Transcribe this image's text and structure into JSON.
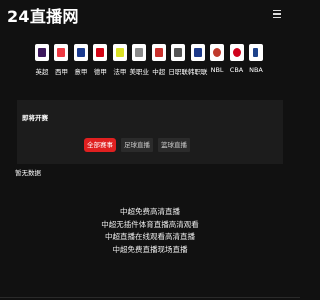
{
  "header": {
    "logo": "24直播网",
    "menu_icon": "hamburger-menu-icon"
  },
  "leagues": [
    {
      "label": "英超",
      "icon": "premier-league-logo",
      "color": "#3d185c"
    },
    {
      "label": "西甲",
      "icon": "laliga-logo",
      "color": "#ee3a43"
    },
    {
      "label": "意甲",
      "icon": "serie-a-logo",
      "color": "#1b3b8f"
    },
    {
      "label": "德甲",
      "icon": "bundesliga-logo",
      "color": "#d20515"
    },
    {
      "label": "法甲",
      "icon": "ligue-1-logo",
      "color": "#dae025"
    },
    {
      "label": "美职业",
      "icon": "mls-logo",
      "color": "#8a8a8a"
    },
    {
      "label": "中超",
      "icon": "csl-logo",
      "color": "#c9302c"
    },
    {
      "label": "日职联",
      "icon": "j-league-logo",
      "color": "#555555"
    },
    {
      "label": "韩职联",
      "icon": "k-league-logo",
      "color": "#1e3a8a"
    },
    {
      "label": "NBL",
      "icon": "nbl-logo",
      "color": "#c0392b"
    },
    {
      "label": "CBA",
      "icon": "cba-logo",
      "color": "#d0021b"
    },
    {
      "label": "NBA",
      "icon": "nba-logo",
      "color": "#1d428a"
    }
  ],
  "panel": {
    "title": "即将开赛",
    "tabs": [
      "全部赛事",
      "足球直播",
      "篮球直播"
    ],
    "active_tab": "全部赛事",
    "accent": "#e02020"
  },
  "empty_text": "暂无数据",
  "footer_links": [
    "中超免费高清直播",
    "中超无插件体育直播高清观看",
    "中超直播在线观看高清直播",
    "中超免费直播现场直播"
  ]
}
